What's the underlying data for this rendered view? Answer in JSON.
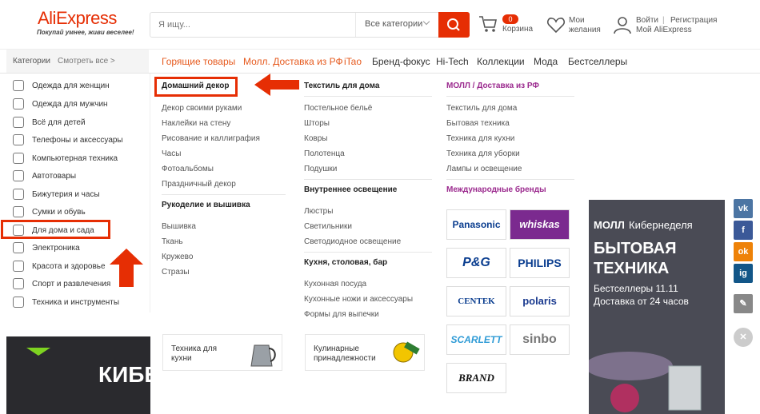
{
  "header": {
    "logo": "AliExpress",
    "tagline": "Покупай умнее, живи веселее!",
    "search_placeholder": "Я ищу...",
    "category_select": "Все категории",
    "cart_count": "0",
    "cart_label": "Корзина",
    "wish_line1": "Мои",
    "wish_line2": "желания",
    "login": "Войти",
    "register": "Регистрация",
    "my_ali": "Мой AliExpress",
    "separator": "|"
  },
  "nav": {
    "categories": "Категории",
    "see_all": "Смотреть все >",
    "links": [
      "Горящие товары",
      "Молл. Доставка из РФ",
      "iTao",
      "Бренд-фокус",
      "Hi-Tech",
      "Коллекции",
      "Мода",
      "Бестселлеры"
    ]
  },
  "left_categories": [
    "Одежда для женщин",
    "Одежда для мужчин",
    "Всё для детей",
    "Телефоны и аксессуары",
    "Компьютерная техника",
    "Автотовары",
    "Бижутерия и часы",
    "Сумки и обувь",
    "Для дома и сада",
    "Электроника",
    "Красота и здоровье",
    "Спорт и развлечения",
    "Техника и инструменты"
  ],
  "col1": {
    "head": "Домашний декор",
    "links": [
      "Декор своими руками",
      "Наклейки на стену",
      "Рисование и каллиграфия",
      "Часы",
      "Фотоальбомы",
      "Праздничный декор"
    ],
    "head2": "Рукоделие и вышивка",
    "links2": [
      "Вышивка",
      "Ткань",
      "Кружево",
      "Стразы"
    ],
    "promo_title1": "Техника для",
    "promo_title2": "кухни"
  },
  "col2": {
    "head": "Текстиль для дома",
    "links": [
      "Постельное бельё",
      "Шторы",
      "Ковры",
      "Полотенца",
      "Подушки"
    ],
    "head2": "Внутреннее освещение",
    "links2": [
      "Люстры",
      "Светильники",
      "Светодиодное освещение"
    ],
    "head3": "Кухня, столовая, бар",
    "links3": [
      "Кухонная посуда",
      "Кухонные ножи и аксессуары",
      "Формы для выпечки"
    ],
    "promo_title1": "Кулинарные",
    "promo_title2": "принадлежности"
  },
  "col3": {
    "head": "МОЛЛ / Доставка из РФ",
    "links": [
      "Текстиль для дома",
      "Бытовая техника",
      "Техника для кухни",
      "Техника для уборки",
      "Лампы и освещение"
    ],
    "head2": "Международные бренды",
    "brands": [
      "Panasonic",
      "whiskas",
      "P&G",
      "PHILIPS",
      "CENTEK",
      "polaris",
      "SCARLETT",
      "sinbo",
      "BRAND"
    ]
  },
  "banner": {
    "title_a": "МОЛЛ",
    "title_b": "Кибернеделя",
    "big1": "БЫТОВАЯ",
    "big2": "ТЕХНИКА",
    "line1": "Бестселлеры 11.11",
    "line2": "Доставка от 24 часов"
  },
  "left_banner": {
    "text": "КИБЕ"
  },
  "social": [
    "vk",
    "f",
    "ok",
    "ig"
  ],
  "colors": {
    "accent": "#e62e04",
    "purple": "#9b2a8e",
    "banner": "#4a4b55"
  }
}
